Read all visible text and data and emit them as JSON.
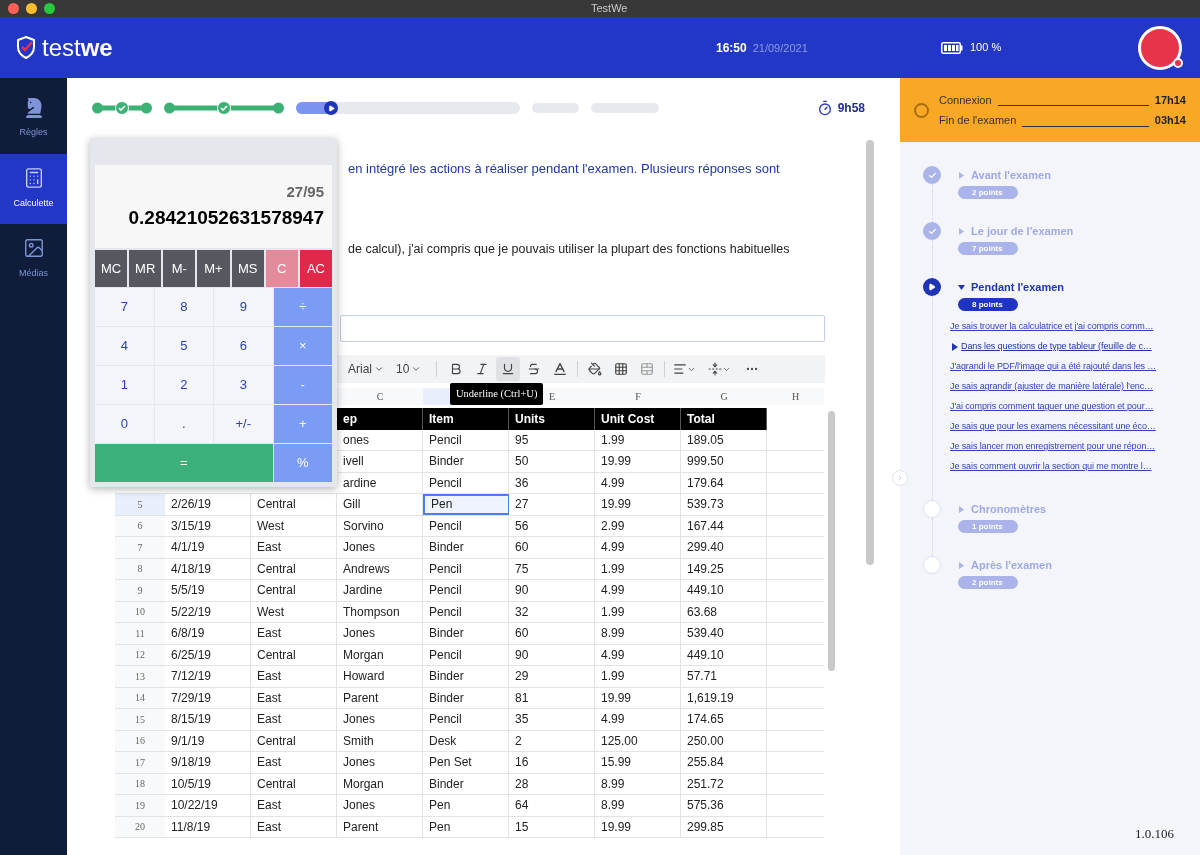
{
  "window": {
    "title": "TestWe"
  },
  "header": {
    "logo": "test**we**",
    "time": "16:50",
    "date": "21/09/2021",
    "battery": "100 %"
  },
  "sidebar": {
    "items": [
      {
        "label": "Règles",
        "selected": false
      },
      {
        "label": "Calculette",
        "selected": true
      },
      {
        "label": "Médias",
        "selected": false
      }
    ]
  },
  "progress": {
    "segments": [
      {
        "kind": "done"
      },
      {
        "kind": "done"
      },
      {
        "kind": "current",
        "level": 0.18
      },
      {
        "kind": "todo"
      },
      {
        "kind": "todo"
      }
    ],
    "timer": "9h58"
  },
  "question": {
    "prompt": "en intégré les actions à réaliser pendant l'examen. Plusieurs réponses sont",
    "statement": "de calcul), j'ai compris que je pouvais utiliser la plupart des fonctions habituelles"
  },
  "spreadsheet": {
    "font": "Arial",
    "font_size": "10",
    "tooltip": "Underline (Ctrl+U)",
    "columns": [
      {
        "letter": "C",
        "selected": false
      },
      {
        "selected": true
      },
      {
        "letter": "E",
        "selected": false
      },
      {
        "letter": "F",
        "selected": false
      },
      {
        "letter": "G",
        "selected": false
      },
      {
        "letter": "H",
        "selected": false
      }
    ],
    "header_row": [
      "ep",
      "Item",
      "Units",
      "Unit Cost",
      "Total"
    ],
    "rows": [
      {
        "selected": false,
        "cells": [
          "ones",
          "Pencil",
          "95",
          "1.99",
          "189.05"
        ]
      },
      {
        "selected": false,
        "cells": [
          "ivell",
          "Binder",
          "50",
          "19.99",
          "999.50"
        ]
      },
      {
        "selected": false,
        "cells": [
          "ardine",
          "Pencil",
          "36",
          "4.99",
          "179.64"
        ]
      },
      {
        "number": "5",
        "selected": true,
        "cells": [
          "2/26/19",
          "Central",
          "Gill",
          "Pen",
          "27",
          "19.99",
          "539.73"
        ]
      },
      {
        "number": "6",
        "selected": false,
        "cells": [
          "3/15/19",
          "West",
          "Sorvino",
          "Pencil",
          "56",
          "2.99",
          "167.44"
        ]
      },
      {
        "number": "7",
        "selected": false,
        "cells": [
          "4/1/19",
          "East",
          "Jones",
          "Binder",
          "60",
          "4.99",
          "299.40"
        ]
      },
      {
        "number": "8",
        "selected": false,
        "cells": [
          "4/18/19",
          "Central",
          "Andrews",
          "Pencil",
          "75",
          "1.99",
          "149.25"
        ]
      },
      {
        "number": "9",
        "selected": false,
        "cells": [
          "5/5/19",
          "Central",
          "Jardine",
          "Pencil",
          "90",
          "4.99",
          "449.10"
        ]
      },
      {
        "number": "10",
        "selected": false,
        "cells": [
          "5/22/19",
          "West",
          "Thompson",
          "Pencil",
          "32",
          "1.99",
          "63.68"
        ]
      },
      {
        "number": "11",
        "selected": false,
        "cells": [
          "6/8/19",
          "East",
          "Jones",
          "Binder",
          "60",
          "8.99",
          "539.40"
        ]
      },
      {
        "number": "12",
        "selected": false,
        "cells": [
          "6/25/19",
          "Central",
          "Morgan",
          "Pencil",
          "90",
          "4.99",
          "449.10"
        ]
      },
      {
        "number": "13",
        "selected": false,
        "cells": [
          "7/12/19",
          "East",
          "Howard",
          "Binder",
          "29",
          "1.99",
          "57.71"
        ]
      },
      {
        "number": "14",
        "selected": false,
        "cells": [
          "7/29/19",
          "East",
          "Parent",
          "Binder",
          "81",
          "19.99",
          "1,619.19"
        ]
      },
      {
        "number": "15",
        "selected": false,
        "cells": [
          "8/15/19",
          "East",
          "Jones",
          "Pencil",
          "35",
          "4.99",
          "174.65"
        ]
      },
      {
        "number": "16",
        "selected": false,
        "cells": [
          "9/1/19",
          "Central",
          "Smith",
          "Desk",
          "2",
          "125.00",
          "250.00"
        ]
      },
      {
        "number": "17",
        "selected": false,
        "cells": [
          "9/18/19",
          "East",
          "Jones",
          "Pen Set",
          "16",
          "15.99",
          "255.84"
        ]
      },
      {
        "number": "18",
        "selected": false,
        "cells": [
          "10/5/19",
          "Central",
          "Morgan",
          "Binder",
          "28",
          "8.99",
          "251.72"
        ]
      },
      {
        "number": "19",
        "selected": false,
        "cells": [
          "10/22/19",
          "East",
          "Jones",
          "Pen",
          "64",
          "8.99",
          "575.36"
        ]
      },
      {
        "number": "20",
        "selected": false,
        "cells": [
          "11/8/19",
          "East",
          "Parent",
          "Pen",
          "15",
          "19.99",
          "299.85"
        ]
      }
    ]
  },
  "calculator": {
    "expression": "27/95",
    "result": "0.28421052631578947",
    "memory_keys": [
      {
        "label": "MC",
        "kind": "memory"
      },
      {
        "label": "MR",
        "kind": "memory"
      },
      {
        "label": "M-",
        "kind": "memory"
      },
      {
        "label": "M+",
        "kind": "memory"
      },
      {
        "label": "MS",
        "kind": "memory"
      },
      {
        "label": "C",
        "kind": "clear"
      },
      {
        "label": "AC",
        "kind": "all-clear"
      }
    ],
    "keys": [
      {
        "label": "7",
        "kind": "digit"
      },
      {
        "label": "8",
        "kind": "digit"
      },
      {
        "label": "9",
        "kind": "digit"
      },
      {
        "label": "÷",
        "kind": "op"
      },
      {
        "label": "4",
        "kind": "digit"
      },
      {
        "label": "5",
        "kind": "digit"
      },
      {
        "label": "6",
        "kind": "digit"
      },
      {
        "label": "×",
        "kind": "op"
      },
      {
        "label": "1",
        "kind": "digit"
      },
      {
        "label": "2",
        "kind": "digit"
      },
      {
        "label": "3",
        "kind": "digit"
      },
      {
        "label": "-",
        "kind": "op"
      },
      {
        "label": "0",
        "kind": "digit"
      },
      {
        "label": ".",
        "kind": "digit"
      },
      {
        "label": "+/-",
        "kind": "digit"
      },
      {
        "label": "+",
        "kind": "op"
      },
      {
        "label": "=",
        "kind": "equals"
      },
      {
        "label": "%",
        "kind": "op"
      }
    ]
  },
  "session": {
    "rows": [
      {
        "label": "Connexion",
        "value": "17h14"
      },
      {
        "label": "Fin de l'examen",
        "value": "03h14"
      }
    ]
  },
  "sections": [
    {
      "title": "Avant l'examen",
      "points": "2 points",
      "kind": "done",
      "expanded": false
    },
    {
      "title": "Le jour de l'examen",
      "points": "7 points",
      "kind": "done",
      "expanded": false
    },
    {
      "title": "Pendant l'examen",
      "points": "8 points",
      "kind": "current",
      "expanded": true,
      "children": [
        {
          "label": "Je sais trouver la calculatrice et j'ai compris comm…",
          "selected": false
        },
        {
          "label": "Dans les questions de type tableur (feuille de c…",
          "selected": true
        },
        {
          "label": "J'agrandi le PDF/l'image qui a été rajouté dans les …",
          "selected": false
        },
        {
          "label": "Je sais agrandir (ajuster de manière latérale) l'enc…",
          "selected": false
        },
        {
          "label": "J'ai compris comment taguer une question et pour…",
          "selected": false
        },
        {
          "label": "Je sais que pour les examens nécessitant une éco…",
          "selected": false
        },
        {
          "label": "Je sais lancer mon enregistrement pour une répon…",
          "selected": false
        },
        {
          "label": "Je sais comment ouvrir la section qui me montre l…",
          "selected": false
        }
      ]
    },
    {
      "title": "Chronomètres",
      "points": "1 points",
      "kind": "todo",
      "expanded": false
    },
    {
      "title": "Après l'examen",
      "points": "2 points",
      "kind": "todo",
      "expanded": false
    }
  ],
  "version": "1.0.106"
}
